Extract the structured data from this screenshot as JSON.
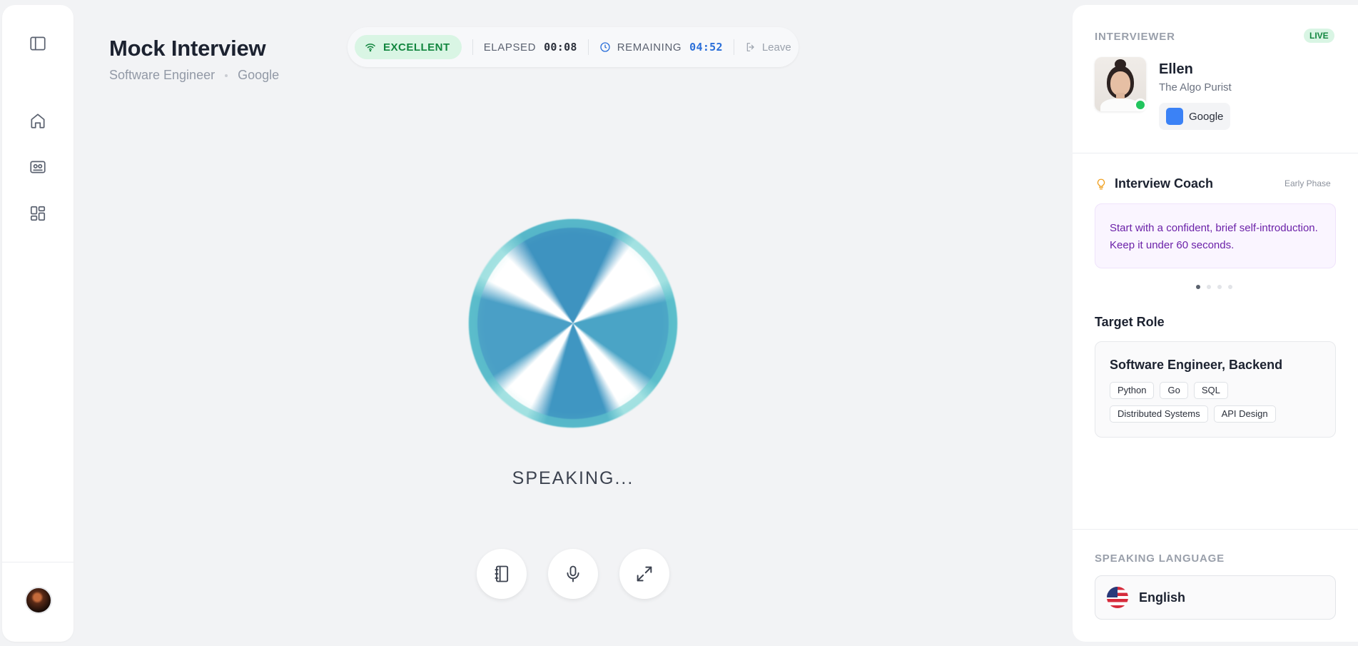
{
  "header": {
    "title": "Mock Interview",
    "role": "Software Engineer",
    "company": "Google"
  },
  "status": {
    "quality": "EXCELLENT",
    "elapsed_label": "ELAPSED",
    "elapsed_value": "00:08",
    "remaining_label": "REMAINING",
    "remaining_value": "04:52",
    "leave_label": "Leave"
  },
  "center": {
    "state_text": "SPEAKING..."
  },
  "sidebar": {
    "items": [
      {
        "icon": "sidebar-toggle-icon"
      },
      {
        "icon": "home-icon"
      },
      {
        "icon": "interview-card-icon"
      },
      {
        "icon": "dashboard-icon"
      }
    ]
  },
  "controls": [
    {
      "icon": "notebook-icon"
    },
    {
      "icon": "microphone-icon"
    },
    {
      "icon": "expand-icon"
    }
  ],
  "interviewer": {
    "section_label": "INTERVIEWER",
    "live_badge": "LIVE",
    "name": "Ellen",
    "title": "The Algo Purist",
    "company": "Google",
    "company_color": "#3b82f6"
  },
  "coach": {
    "title": "Interview Coach",
    "phase": "Early Phase",
    "tip": "Start with a confident, brief self-introduction. Keep it under 60 seconds.",
    "pages": 4,
    "active_page": 1
  },
  "target_role": {
    "title": "Target Role",
    "role": "Software Engineer, Backend",
    "skills": [
      "Python",
      "Go",
      "SQL",
      "Distributed Systems",
      "API Design"
    ]
  },
  "language": {
    "section_label": "SPEAKING LANGUAGE",
    "value": "English",
    "flag": "us-flag-icon"
  },
  "colors": {
    "accent_green": "#12863f",
    "accent_blue": "#2b6fd9",
    "coach_purple": "#6b21a8",
    "online_green": "#22c55e"
  }
}
